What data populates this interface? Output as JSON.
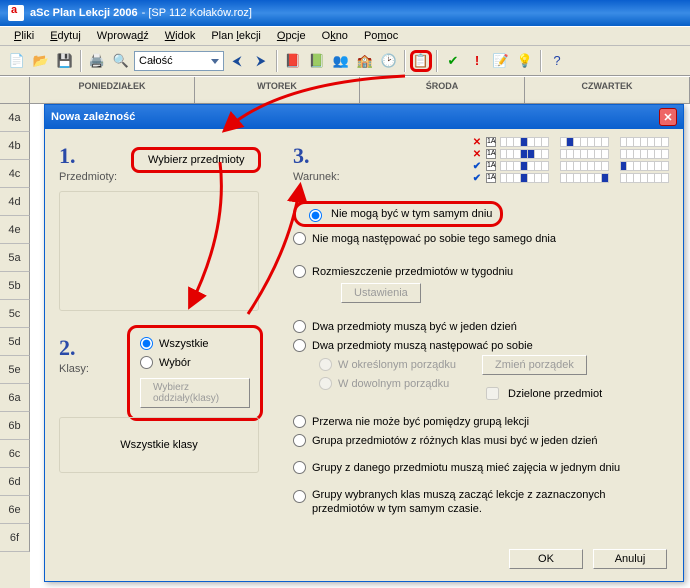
{
  "app": {
    "title": "aSc Plan Lekcji 2006",
    "doc": "- [SP 112 Kołaków.roz]"
  },
  "menu": [
    "Pliki",
    "Edytuj",
    "Wprowadź",
    "Widok",
    "Plan lekcji",
    "Opcje",
    "Okno",
    "Pomoc"
  ],
  "toolbar": {
    "combo": "Całość"
  },
  "days": [
    "PONIEDZIAŁEK",
    "WTOREK",
    "ŚRODA",
    "CZWARTEK"
  ],
  "rows": [
    "4a",
    "4b",
    "4c",
    "4d",
    "4e",
    "5a",
    "5b",
    "5c",
    "5d",
    "5e",
    "6a",
    "6b",
    "6c",
    "6d",
    "6e",
    "6f"
  ],
  "dialog": {
    "title": "Nowa zależność",
    "step1": "1.",
    "step1_label": "Przedmioty:",
    "step1_btn": "Wybierz przedmioty",
    "step2": "2.",
    "step2_label": "Klasy:",
    "step2_r1": "Wszystkie",
    "step2_r2": "Wybór",
    "step2_btn": "Wybierz oddziały(klasy)",
    "step2_status": "Wszystkie klasy",
    "step3": "3.",
    "step3_label": "Warunek:",
    "cond": {
      "c1": "Nie mogą być w tym samym dniu",
      "c2": "Nie mogą następować po sobie tego samego dnia",
      "c3": "Rozmieszczenie przedmiotów w tygodniu",
      "c3_btn": "Ustawienia",
      "c4": "Dwa przedmioty muszą być w jeden dzień",
      "c5": "Dwa przedmioty muszą następować po sobie",
      "c5_sub1": "W określonym porządku",
      "c5_sub2": "W dowolnym porządku",
      "c5_btn": "Zmień porządek",
      "c5_chk": "Dzielone przedmiot",
      "c6": "Przerwa nie może być pomiędzy grupą lekcji",
      "c7": "Grupa przedmiotów z różnych klas musi być w jeden dzień",
      "c8": "Grupy z danego przedmiotu muszą mieć zajęcia w jednym dniu",
      "c9": "Grupy wybranych klas muszą zacząć lekcje z zaznaczonych przedmiotów w tym samym czasie."
    },
    "ok": "OK",
    "cancel": "Anuluj"
  }
}
